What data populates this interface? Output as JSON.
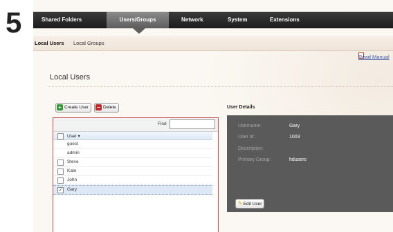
{
  "step_number": "5",
  "nav": {
    "tabs": [
      {
        "label": "Shared Folders"
      },
      {
        "label": "Users/Groups",
        "active": true
      },
      {
        "label": "Network"
      },
      {
        "label": "System"
      },
      {
        "label": "Extensions"
      }
    ]
  },
  "subnav": {
    "tabs": [
      {
        "label": "Local Users",
        "active": true
      },
      {
        "label": "Local Groups"
      }
    ]
  },
  "help_link": "Read Manual",
  "page_title": "Local Users",
  "toolbar": {
    "create_label": "Create User",
    "delete_label": "Delete"
  },
  "list": {
    "find_label": "Find",
    "find_value": "",
    "column_header": "User ▾",
    "rows": [
      {
        "name": "guest",
        "checkbox": false,
        "checked": false
      },
      {
        "name": "admin",
        "checkbox": false,
        "checked": false
      },
      {
        "name": "Steve",
        "checkbox": true,
        "checked": false
      },
      {
        "name": "Kate",
        "checkbox": true,
        "checked": false
      },
      {
        "name": "John",
        "checkbox": true,
        "checked": false
      },
      {
        "name": "Gary",
        "checkbox": true,
        "checked": true,
        "selected": true
      }
    ]
  },
  "details": {
    "title": "User Details",
    "fields": [
      {
        "label": "Username:",
        "value": "Gary"
      },
      {
        "label": "User Id:",
        "value": "1003"
      },
      {
        "label": "Description:",
        "value": ""
      },
      {
        "label": "Primary Group:",
        "value": "hdusers"
      }
    ],
    "edit_label": "Edit User"
  },
  "colors": {
    "nav_bg": "#1c1c1c",
    "details_bg": "#5a5a5a",
    "list_border": "#c9484b",
    "selected_row": "#dde8f6",
    "link": "#3c59a8"
  }
}
